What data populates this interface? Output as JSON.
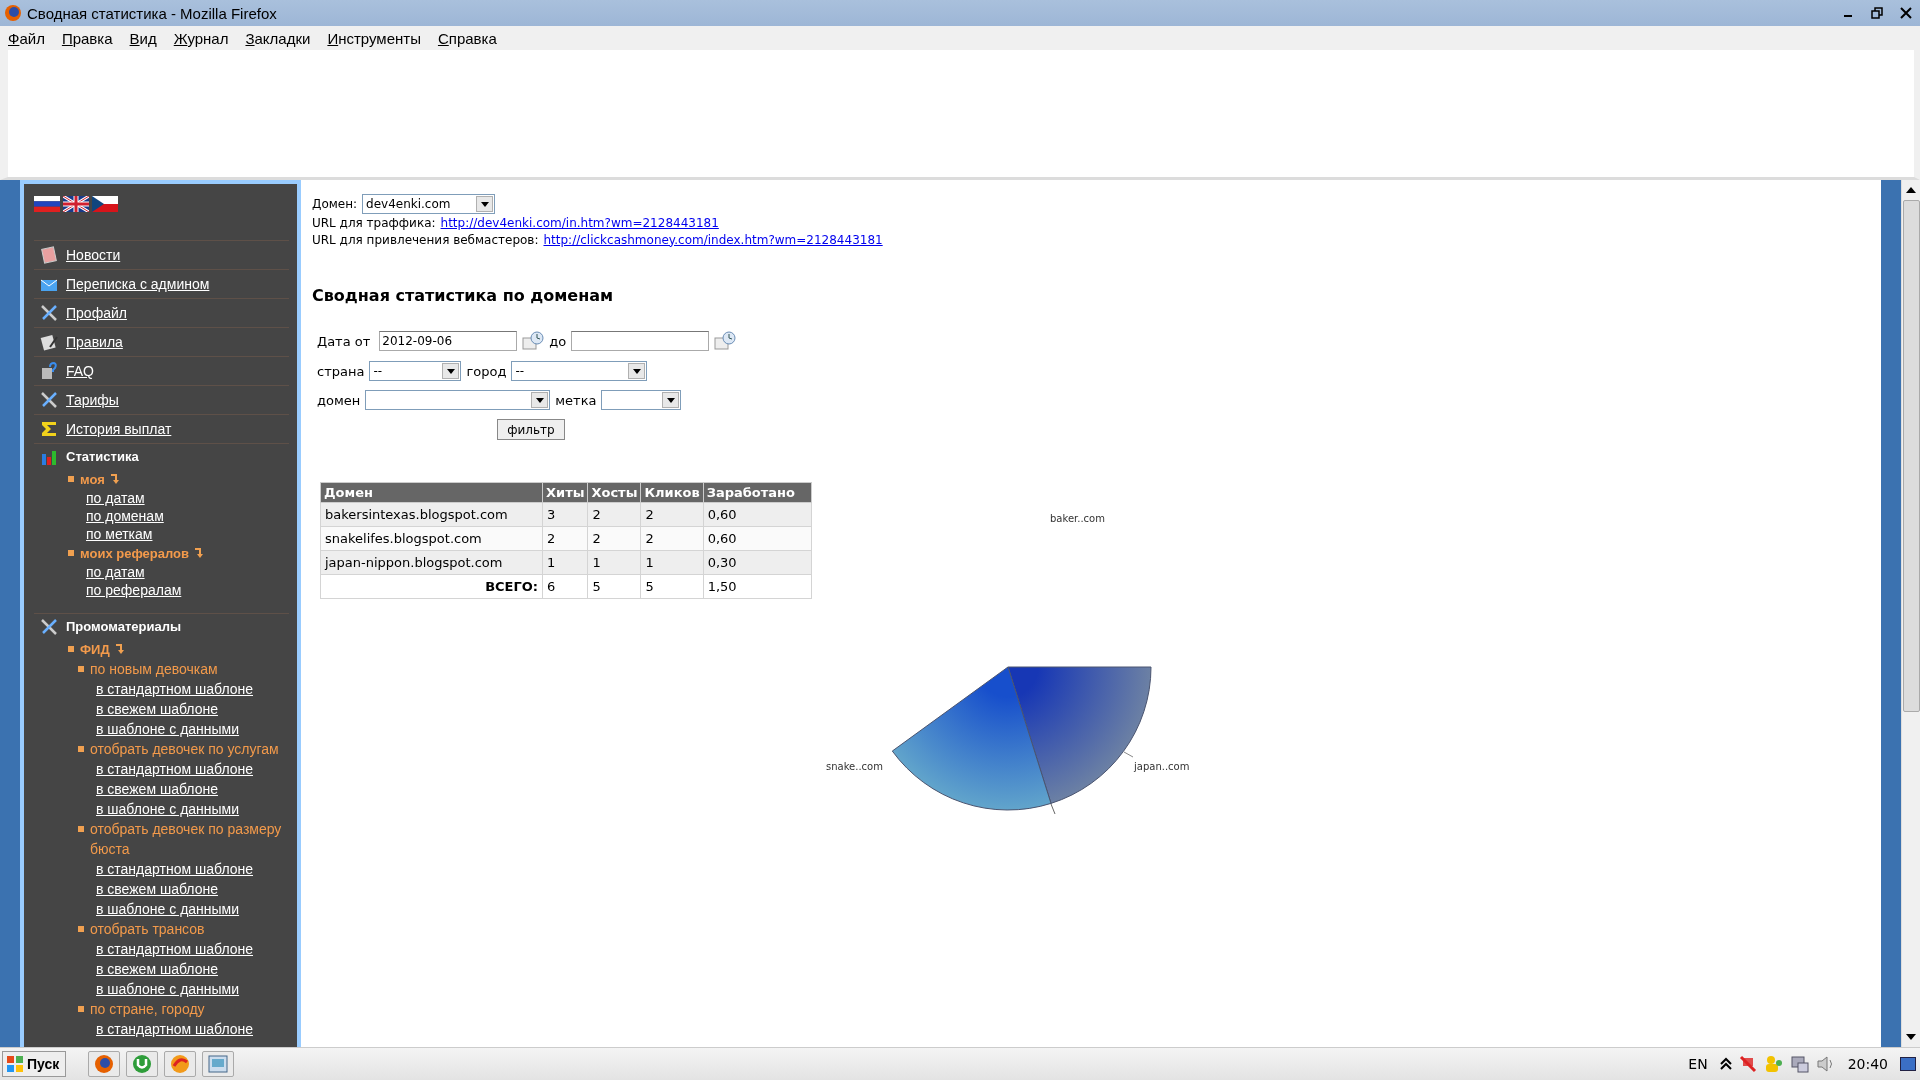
{
  "window": {
    "title": "Сводная статистика - Mozilla Firefox"
  },
  "menu": [
    "Файл",
    "Правка",
    "Вид",
    "Журнал",
    "Закладки",
    "Инструменты",
    "Справка"
  ],
  "sidebar": {
    "nav": [
      {
        "label": "Новости"
      },
      {
        "label": "Переписка с админом"
      },
      {
        "label": "Профайл"
      },
      {
        "label": "Правила"
      },
      {
        "label": "FAQ"
      },
      {
        "label": "Тарифы"
      },
      {
        "label": "История выплат"
      }
    ],
    "statistics": {
      "label": "Статистика",
      "groups": [
        {
          "label": "моя",
          "links": [
            "по датам",
            "по доменам",
            "по меткам"
          ]
        },
        {
          "label": "моих рефералов",
          "links": [
            "по датам",
            "по рефералам"
          ]
        }
      ]
    },
    "promo": {
      "label": "Промоматериалы",
      "groups": [
        {
          "label": "ФИД",
          "children": [
            {
              "label": "по новым девочкам",
              "links": [
                "в стандартном шаблоне",
                "в свежем шаблоне",
                "в шаблоне с данными"
              ]
            },
            {
              "label": "отобрать девочек по услугам",
              "links": [
                "в стандартном шаблоне",
                "в свежем шаблоне",
                "в шаблоне с данными"
              ]
            },
            {
              "label": "отобрать девочек по размеру бюста",
              "links": [
                "в стандартном шаблоне",
                "в свежем шаблоне",
                "в шаблоне с данными"
              ]
            },
            {
              "label": "отобрать трансов",
              "links": [
                "в стандартном шаблоне",
                "в свежем шаблоне",
                "в шаблоне с данными"
              ]
            },
            {
              "label": "по стране, городу",
              "links": [
                "в стандартном шаблоне"
              ]
            }
          ]
        }
      ]
    }
  },
  "domain_select": {
    "label": "Домен:",
    "value": "dev4enki.com"
  },
  "urls": [
    {
      "label": "URL для траффика:",
      "link": "http://dev4enki.com/in.htm?wm=2128443181"
    },
    {
      "label": "URL для привлечения вебмастеров:",
      "link": "http://clickcashmoney.com/index.htm?wm=2128443181"
    }
  ],
  "heading": "Сводная статистика по доменам",
  "filter": {
    "date_from": {
      "label": "Дата от",
      "value": "2012-09-06"
    },
    "date_to": {
      "label": "до"
    },
    "country": {
      "label": "страна",
      "value": "--"
    },
    "city": {
      "label": "город",
      "value": "--"
    },
    "domain": {
      "label": "домен"
    },
    "tag": {
      "label": "метка"
    },
    "button": "фильтр"
  },
  "table": {
    "columns": [
      "Домен",
      "Хиты",
      "Хосты",
      "Кликов",
      "Заработано"
    ],
    "rows": [
      [
        "bakersintexas.blogspot.com",
        "3",
        "2",
        "2",
        "0,60"
      ],
      [
        "snakelifes.blogspot.com",
        "2",
        "2",
        "2",
        "0,60"
      ],
      [
        "japan-nippon.blogspot.com",
        "1",
        "1",
        "1",
        "0,30"
      ]
    ],
    "total": {
      "label": "ВСЕГО:",
      "values": [
        "6",
        "5",
        "5",
        "1,50"
      ]
    }
  },
  "pie_labels": [
    "baker..com",
    "snake..com",
    "japan..com"
  ],
  "taskbar": {
    "start": "Пуск",
    "language": "EN",
    "clock": "20:40"
  }
}
